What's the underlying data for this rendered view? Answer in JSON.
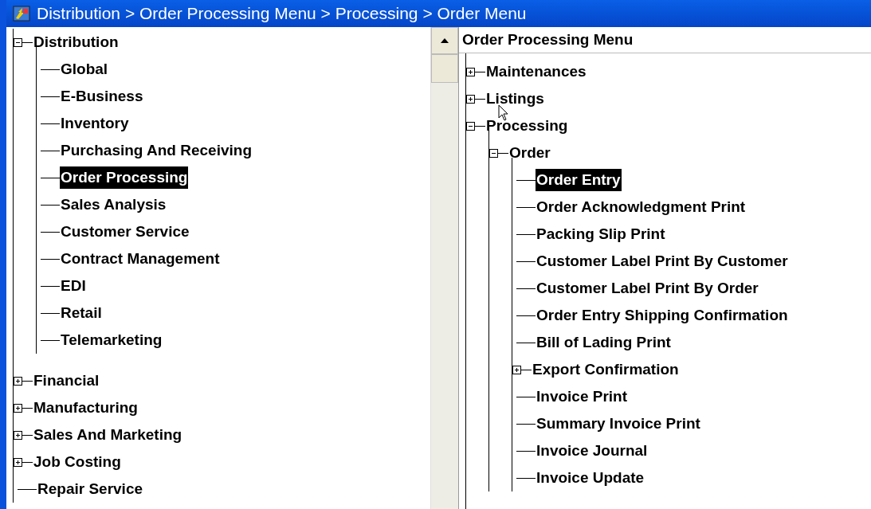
{
  "window": {
    "title": "Distribution > Order Processing Menu > Processing > Order Menu"
  },
  "left_tree": [
    {
      "label": "Distribution",
      "kind": "node",
      "expanded": true,
      "selected": false,
      "children": [
        {
          "label": "Global",
          "kind": "leaf",
          "selected": false
        },
        {
          "label": "E-Business",
          "kind": "leaf",
          "selected": false
        },
        {
          "label": "Inventory",
          "kind": "leaf",
          "selected": false
        },
        {
          "label": "Purchasing And Receiving",
          "kind": "leaf",
          "selected": false
        },
        {
          "label": "Order Processing",
          "kind": "leaf",
          "selected": true
        },
        {
          "label": "Sales Analysis",
          "kind": "leaf",
          "selected": false
        },
        {
          "label": "Customer Service",
          "kind": "leaf",
          "selected": false
        },
        {
          "label": "Contract Management",
          "kind": "leaf",
          "selected": false
        },
        {
          "label": "EDI",
          "kind": "leaf",
          "selected": false
        },
        {
          "label": "Retail",
          "kind": "leaf",
          "selected": false
        },
        {
          "label": "Telemarketing",
          "kind": "leaf",
          "selected": false
        }
      ]
    },
    {
      "label": "Financial",
      "kind": "node",
      "expanded": false,
      "selected": false
    },
    {
      "label": "Manufacturing",
      "kind": "node",
      "expanded": false,
      "selected": false
    },
    {
      "label": "Sales And Marketing",
      "kind": "node",
      "expanded": false,
      "selected": false
    },
    {
      "label": "Job Costing",
      "kind": "node",
      "expanded": false,
      "selected": false
    },
    {
      "label": "Repair Service",
      "kind": "leaf",
      "selected": false
    }
  ],
  "right_panel": {
    "title": "Order Processing Menu",
    "tree": [
      {
        "label": "Maintenances",
        "kind": "node",
        "expanded": false,
        "selected": false
      },
      {
        "label": "Listings",
        "kind": "node",
        "expanded": false,
        "selected": false
      },
      {
        "label": "Processing",
        "kind": "node",
        "expanded": true,
        "selected": false,
        "children": [
          {
            "label": "Order",
            "kind": "node",
            "expanded": true,
            "selected": false,
            "children": [
              {
                "label": "Order Entry",
                "kind": "leaf",
                "selected": true
              },
              {
                "label": "Order Acknowledgment Print",
                "kind": "leaf",
                "selected": false
              },
              {
                "label": "Packing Slip Print",
                "kind": "leaf",
                "selected": false
              },
              {
                "label": "Customer Label Print By Customer",
                "kind": "leaf",
                "selected": false
              },
              {
                "label": "Customer Label Print By Order",
                "kind": "leaf",
                "selected": false
              },
              {
                "label": "Order Entry Shipping Confirmation",
                "kind": "leaf",
                "selected": false
              },
              {
                "label": "Bill of Lading Print",
                "kind": "leaf",
                "selected": false
              },
              {
                "label": "Export Confirmation",
                "kind": "node",
                "expanded": false,
                "selected": false
              },
              {
                "label": "Invoice Print",
                "kind": "leaf",
                "selected": false
              },
              {
                "label": "Summary Invoice Print",
                "kind": "leaf",
                "selected": false
              },
              {
                "label": "Invoice Journal",
                "kind": "leaf",
                "selected": false
              },
              {
                "label": "Invoice Update",
                "kind": "leaf",
                "selected": false
              }
            ]
          }
        ]
      }
    ]
  }
}
